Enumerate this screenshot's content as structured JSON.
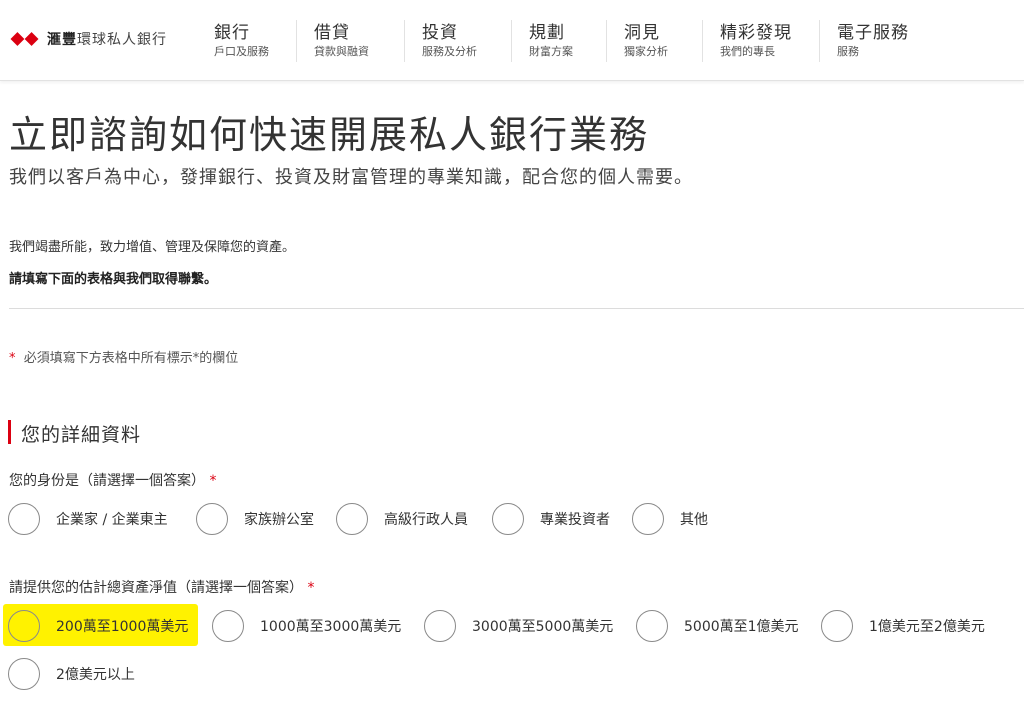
{
  "brand": {
    "name": "滙豐",
    "subtitle": "環球私人銀行",
    "logo_icon": "hexagon-logo-icon",
    "logo_color": "#db0011"
  },
  "nav": [
    {
      "title": "銀行",
      "subtitle": "戶口及服務"
    },
    {
      "title": "借貸",
      "subtitle": "貸款與融資"
    },
    {
      "title": "投資",
      "subtitle": "服務及分析"
    },
    {
      "title": "規劃",
      "subtitle": "財富方案"
    },
    {
      "title": "洞見",
      "subtitle": "獨家分析"
    },
    {
      "title": "精彩發現",
      "subtitle": "我們的專長"
    },
    {
      "title": "電子服務",
      "subtitle": "服務"
    }
  ],
  "hero": {
    "title": "立即諮詢如何快速開展私人銀行業務",
    "subtitle": "我們以客戶為中心，發揮銀行、投資及財富管理的專業知識，配合您的個人需要。"
  },
  "intro": {
    "line1": "我們竭盡所能，致力增值、管理及保障您的資產。",
    "line2": "請填寫下面的表格與我們取得聯繫。"
  },
  "form": {
    "required_marker": "*",
    "required_note": "必須填寫下方表格中所有標示*的欄位",
    "section_title": "您的詳細資料",
    "identity": {
      "label": "您的身份是（請選擇一個答案）",
      "options": [
        "企業家 / 企業東主",
        "家族辦公室",
        "高級行政人員",
        "專業投資者",
        "其他"
      ]
    },
    "net_worth": {
      "label": "請提供您的估計總資產淨值（請選擇一個答案）",
      "options": [
        "200萬至1000萬美元",
        "1000萬至3000萬美元",
        "3000萬至5000萬美元",
        "5000萬至1億美元",
        "1億美元至2億美元",
        "2億美元以上"
      ],
      "highlighted_option": "200萬至1000萬美元"
    }
  },
  "colors": {
    "accent": "#db0011",
    "highlight": "#fff200",
    "text": "#333333"
  }
}
